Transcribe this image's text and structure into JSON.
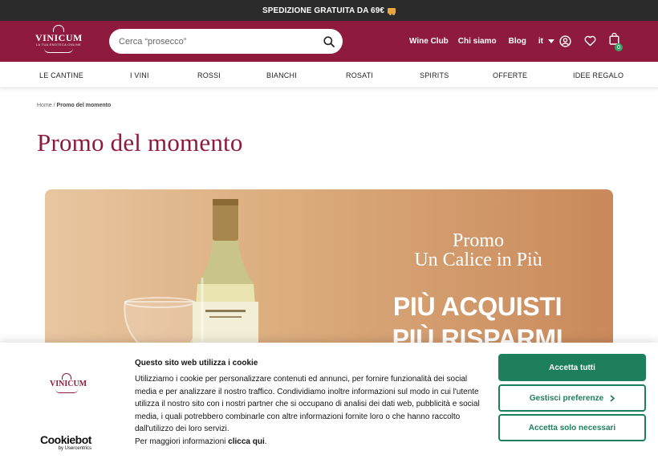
{
  "topbar": {
    "text": "SPEDIZIONE GRATUITA DA 69€",
    "icon": "truck-icon"
  },
  "header": {
    "logo": {
      "name": "VINICUM",
      "tagline": "LA TUA ENOTECA ONLINE"
    },
    "search": {
      "placeholder": "Cerca “prosecco”"
    },
    "nav": [
      "Wine Club",
      "Chi siamo",
      "Blog"
    ],
    "language": "it",
    "cart_count": "0"
  },
  "categories": [
    "LE CANTINE",
    "I VINI",
    "ROSSI",
    "BIANCHI",
    "ROSATI",
    "SPIRITS",
    "OFFERTE",
    "IDEE REGALO"
  ],
  "breadcrumb": {
    "home": "Home",
    "separator": "/",
    "current": "Promo del momento"
  },
  "page_title": "Promo del momento",
  "banner": {
    "promo_line1": "Promo",
    "promo_line2": "Un Calice in Più",
    "headline1": "PIÙ ACQUISTI",
    "headline2": "PIÙ RISPARMI"
  },
  "cookie_banner": {
    "title": "Questo sito web utilizza i cookie",
    "body": "Utilizziamo i cookie per personalizzare contenuti ed annunci, per fornire funzionalità dei social media e per analizzare il nostro traffico. Condividiamo inoltre informazioni sul modo in cui l'utente utilizza il nostro sito con i nostri partner che si occupano di analisi dei dati web, pubblicità e social media, i quali potrebbero combinarle con altre informazioni fornite loro o che hanno raccolto dall'utilizzo dei loro servizi.",
    "more_prefix": "Per maggiori informazioni",
    "more_link": "clicca qui",
    "more_suffix": ".",
    "logo_name": "VINICUM",
    "cookiebot_brand": "Cookiebot",
    "cookiebot_by": "by Usercentrics",
    "accept_all": "Accetta tutti",
    "manage": "Gestisci preferenze",
    "accept_necessary": "Accetta solo necessari"
  },
  "colors": {
    "brand": "#8e1b3e",
    "accent": "#1e7f5c",
    "topbar": "#2b2b2b"
  }
}
